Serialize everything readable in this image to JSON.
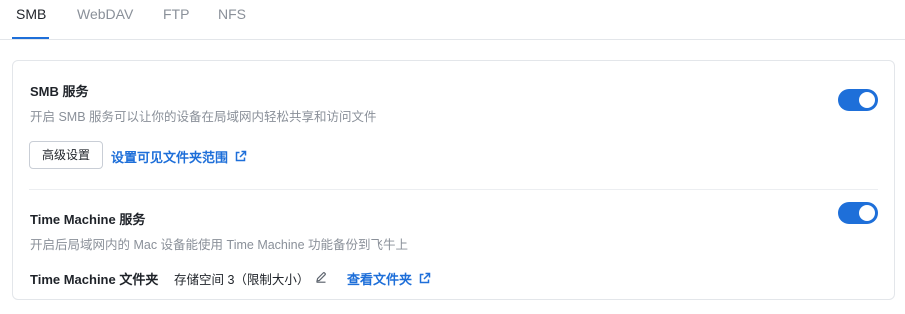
{
  "tabs": {
    "items": [
      {
        "label": "SMB",
        "active": true
      },
      {
        "label": "WebDAV",
        "active": false
      },
      {
        "label": "FTP",
        "active": false
      },
      {
        "label": "NFS",
        "active": false
      }
    ],
    "accent_color": "#1e6fd9"
  },
  "smb": {
    "title": "SMB 服务",
    "description": "开启 SMB 服务可以让你的设备在局域网内轻松共享和访问文件",
    "enabled": true,
    "advanced_button": "高级设置",
    "visible_folders_link": "设置可见文件夹范围",
    "link_icon": "external-link-icon"
  },
  "time_machine": {
    "title": "Time Machine 服务",
    "description": "开启后局域网内的 Mac 设备能使用 Time Machine 功能备份到飞牛上",
    "enabled": true,
    "folder_label": "Time Machine 文件夹",
    "folder_value": "存储空间 3（限制大小）",
    "edit_icon": "pencil-icon",
    "view_folder_link": "查看文件夹",
    "link_icon": "external-link-icon"
  },
  "colors": {
    "toggle_on": "#1e6fd9",
    "link": "#1e6fd9",
    "muted_text": "#8a9099"
  }
}
